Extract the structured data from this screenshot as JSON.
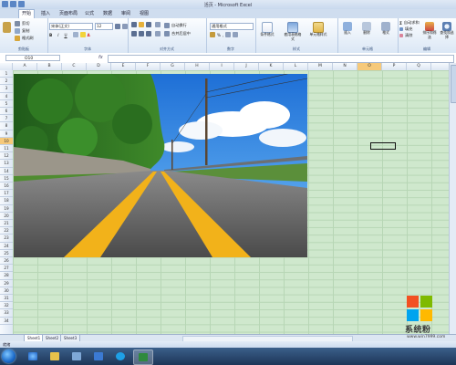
{
  "window": {
    "title": "活页 - Microsoft Excel"
  },
  "ribbon": {
    "tabs": [
      "开始",
      "插入",
      "页面布局",
      "公式",
      "数据",
      "审阅",
      "视图"
    ],
    "active_tab": 0,
    "clipboard": {
      "cut": "剪切",
      "copy": "复制",
      "format_painter": "格式刷",
      "label": "剪贴板"
    },
    "font": {
      "name": "宋体(正文)",
      "size": "12",
      "bold": "B",
      "italic": "I",
      "underline": "U",
      "font_color": "A",
      "label": "字体"
    },
    "alignment": {
      "wrap": "自动换行",
      "merge": "合并后居中",
      "label": "对齐方式"
    },
    "number": {
      "format": "通用格式",
      "percent": "%",
      "comma": ",",
      "label": "数字"
    },
    "styles": {
      "conditional": "条件格式",
      "as_table": "套用表格格式",
      "cell_styles": "单元格样式",
      "label": "样式"
    },
    "cells": {
      "insert": "插入",
      "delete": "删除",
      "format": "格式",
      "label": "单元格"
    },
    "editing": {
      "autosum": "自动求和",
      "fill": "填充",
      "clear": "清除",
      "sort": "排序和筛选",
      "find": "查找和选择",
      "label": "编辑"
    }
  },
  "formula_bar": {
    "name_box": "O10",
    "fx": "fx",
    "value": ""
  },
  "columns": [
    "A",
    "B",
    "C",
    "D",
    "E",
    "F",
    "G",
    "H",
    "I",
    "J",
    "K",
    "L",
    "M",
    "N",
    "O",
    "P",
    "Q"
  ],
  "selected_column": "O",
  "rows": [
    "1",
    "2",
    "3",
    "4",
    "5",
    "6",
    "7",
    "8",
    "9",
    "10",
    "11",
    "12",
    "13",
    "14",
    "15",
    "16",
    "17",
    "18",
    "19",
    "20",
    "21",
    "22",
    "23",
    "24",
    "25",
    "26",
    "27",
    "28",
    "29",
    "30",
    "31",
    "32",
    "33",
    "34"
  ],
  "selected_row": "10",
  "sheets": [
    "Sheet1",
    "Sheet2",
    "Sheet3"
  ],
  "active_sheet": 0,
  "status": {
    "ready": "就绪"
  },
  "watermark": {
    "name": "系统粉",
    "url": "www.win7999.com"
  },
  "colors": {
    "grid_fill": "#cfe8cd",
    "selection_header": "#f6c97a",
    "ribbon_bg": "#dbe7f5"
  }
}
